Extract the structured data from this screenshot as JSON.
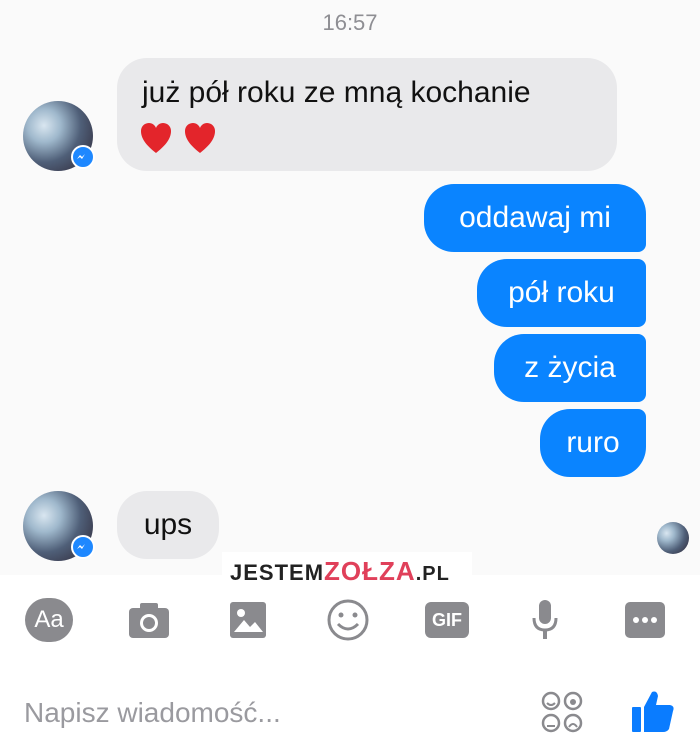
{
  "status": {
    "time": "16:57"
  },
  "messages": {
    "incoming_1": {
      "text": "już pół roku ze mną kochanie",
      "hearts": "❤️❤️"
    },
    "outgoing": [
      "oddawaj mi",
      "pół roku",
      "z życia",
      "ruro"
    ],
    "incoming_2": {
      "text": "ups"
    }
  },
  "watermark": {
    "part1": "JESTEM",
    "part2": "ZOŁZA",
    "part3": ".PL"
  },
  "composer": {
    "aa_label": "Aa",
    "gif_label": "GIF",
    "placeholder": "Napisz wiadomość..."
  },
  "colors": {
    "outgoing_bubble": "#0a84ff",
    "incoming_bubble": "#e9e9eb",
    "icon_gray": "#8a8a8e",
    "like_blue": "#0a7cff"
  },
  "icons": [
    "messenger-badge-icon",
    "camera-icon",
    "image-icon",
    "emoji-icon",
    "gif-icon",
    "microphone-icon",
    "more-icon",
    "emoji-options-icon",
    "thumbs-up-icon"
  ]
}
